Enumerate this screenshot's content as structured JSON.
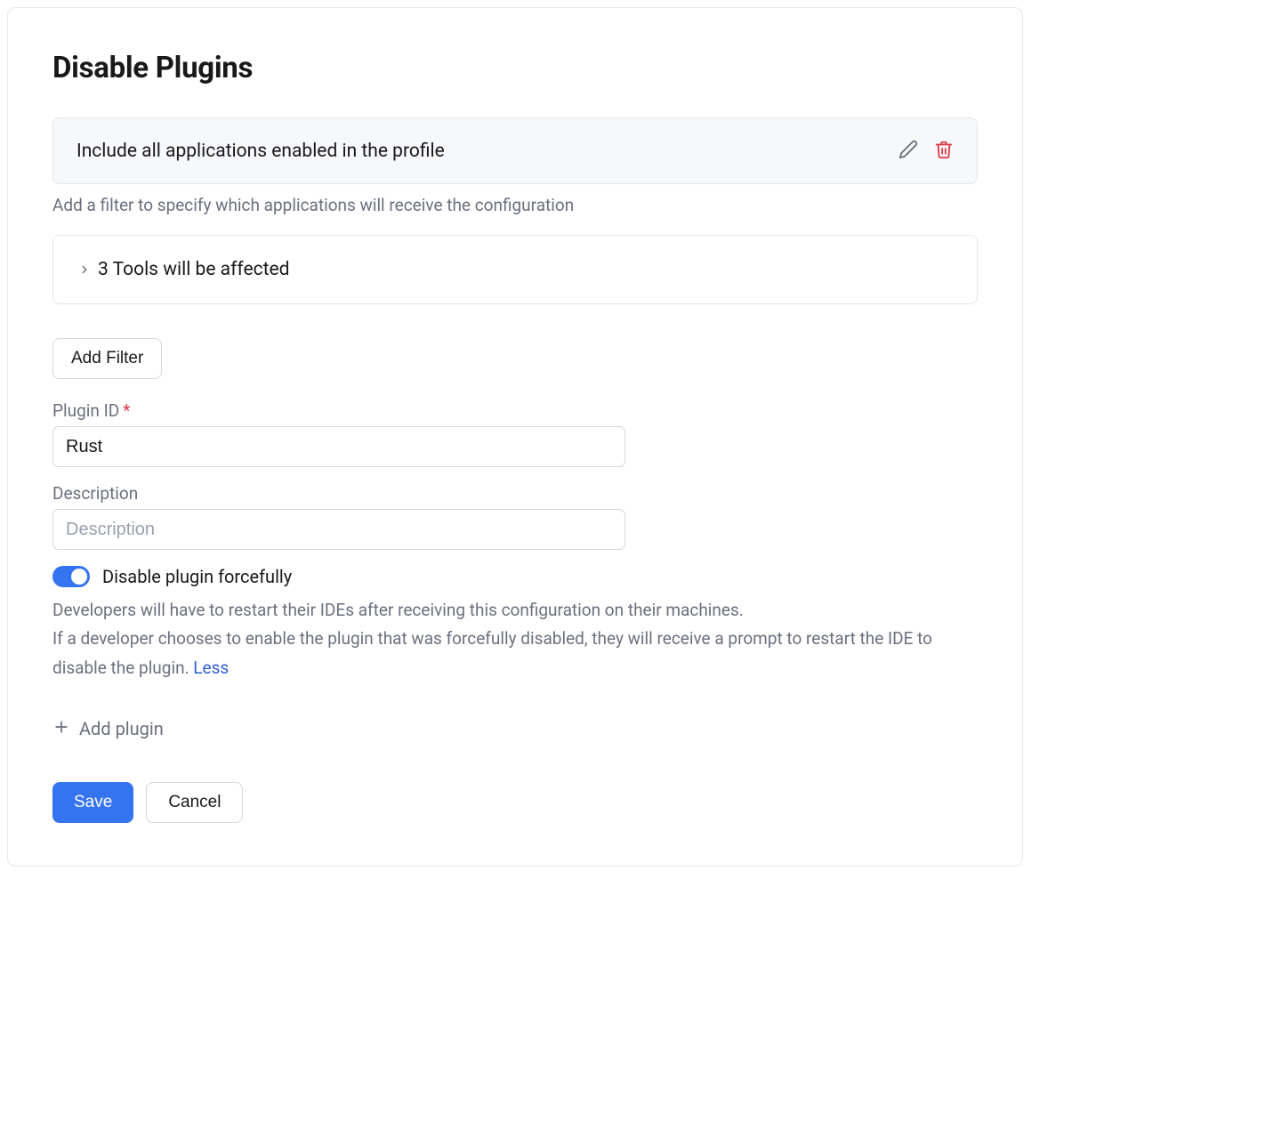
{
  "page_title": "Disable Plugins",
  "profile_card": {
    "label": "Include all applications enabled in the profile"
  },
  "filter_hint": "Add a filter to specify which applications will receive the configuration",
  "affected_card": {
    "label": "3 Tools will be affected"
  },
  "add_filter_button": "Add Filter",
  "plugin_id_field": {
    "label": "Plugin ID",
    "required_mark": "*",
    "value": "Rust"
  },
  "description_field": {
    "label": "Description",
    "placeholder": "Description",
    "value": ""
  },
  "forceful_toggle": {
    "label": "Disable plugin forcefully",
    "on": true,
    "help_line1": "Developers will have to restart their IDEs after receiving this configuration on their machines.",
    "help_line2": "If a developer chooses to enable the plugin that was forcefully disabled, they will receive a prompt to restart the IDE to disable the plugin.",
    "less_label": "Less"
  },
  "add_plugin_button": "Add plugin",
  "buttons": {
    "save": "Save",
    "cancel": "Cancel"
  },
  "icons": {
    "edit": "edit-icon",
    "delete": "delete-icon",
    "chevron_right": "chevron-right-icon",
    "plus": "plus-icon"
  },
  "colors": {
    "primary": "#3574f0",
    "danger": "#db3b4b",
    "muted": "#6c707e"
  }
}
